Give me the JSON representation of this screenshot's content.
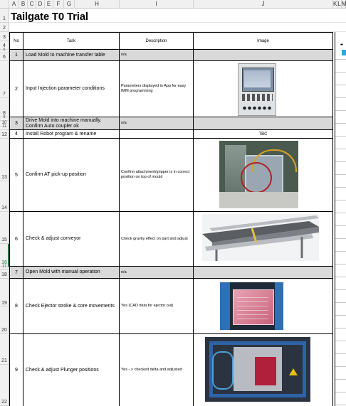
{
  "columns": [
    "A",
    "B",
    "C",
    "D",
    "E",
    "F",
    "G",
    "H",
    "I",
    "J",
    "K",
    "L",
    "M"
  ],
  "rows": [
    "1",
    "2",
    "3",
    "4",
    "5",
    "6",
    "7",
    "8",
    "9",
    "10",
    "11",
    "12",
    "13",
    "14",
    "15",
    "16",
    "17",
    "18",
    "19",
    "20",
    "21",
    "22"
  ],
  "title": "Tailgate T0 Trial",
  "table_header": {
    "no": "No",
    "task": "Task",
    "description": "Description",
    "image": "Image"
  },
  "tasks": [
    {
      "no": "1",
      "task": "Load Mold to machine transfer table",
      "description": "n/a",
      "image": ""
    },
    {
      "no": "2",
      "task": "Input Injection parameter conditions",
      "description": "Parameters displayed in App for easy IMM programming",
      "image": "[control panel photo]"
    },
    {
      "no": "3",
      "task": "Drive Mold into machine manually. Confirm Auto coupler ok",
      "description": "n/a",
      "image": ""
    },
    {
      "no": "4",
      "task": "Install Robot program & rename",
      "description": "",
      "image": "TBC"
    },
    {
      "no": "5",
      "task": "Confirm AT pick-up position",
      "description": "Confirm attachment/gripper is in correct position on top of mould",
      "image": "[gripper photo]"
    },
    {
      "no": "6",
      "task": "Check & adjust conveyor",
      "description": "Check gravity effect on part and adjust",
      "image": "[conveyor render]"
    },
    {
      "no": "7",
      "task": "Open Mold with manual operation",
      "description": "n/a",
      "image": ""
    },
    {
      "no": "8",
      "task": "Check Ejector stroke & core movements",
      "description": "Yes (CAD data for ejector out)",
      "image": "[mould CAD photo]"
    },
    {
      "no": "9",
      "task": "Check & adjust Plunger  positions",
      "description": "Yes - > checked delta and adjusted",
      "image": "[plunger photo]"
    }
  ],
  "colors": {
    "shade": "#d9d9d9",
    "header_bg": "#f0f0f0",
    "grid": "#e3e3e3"
  }
}
